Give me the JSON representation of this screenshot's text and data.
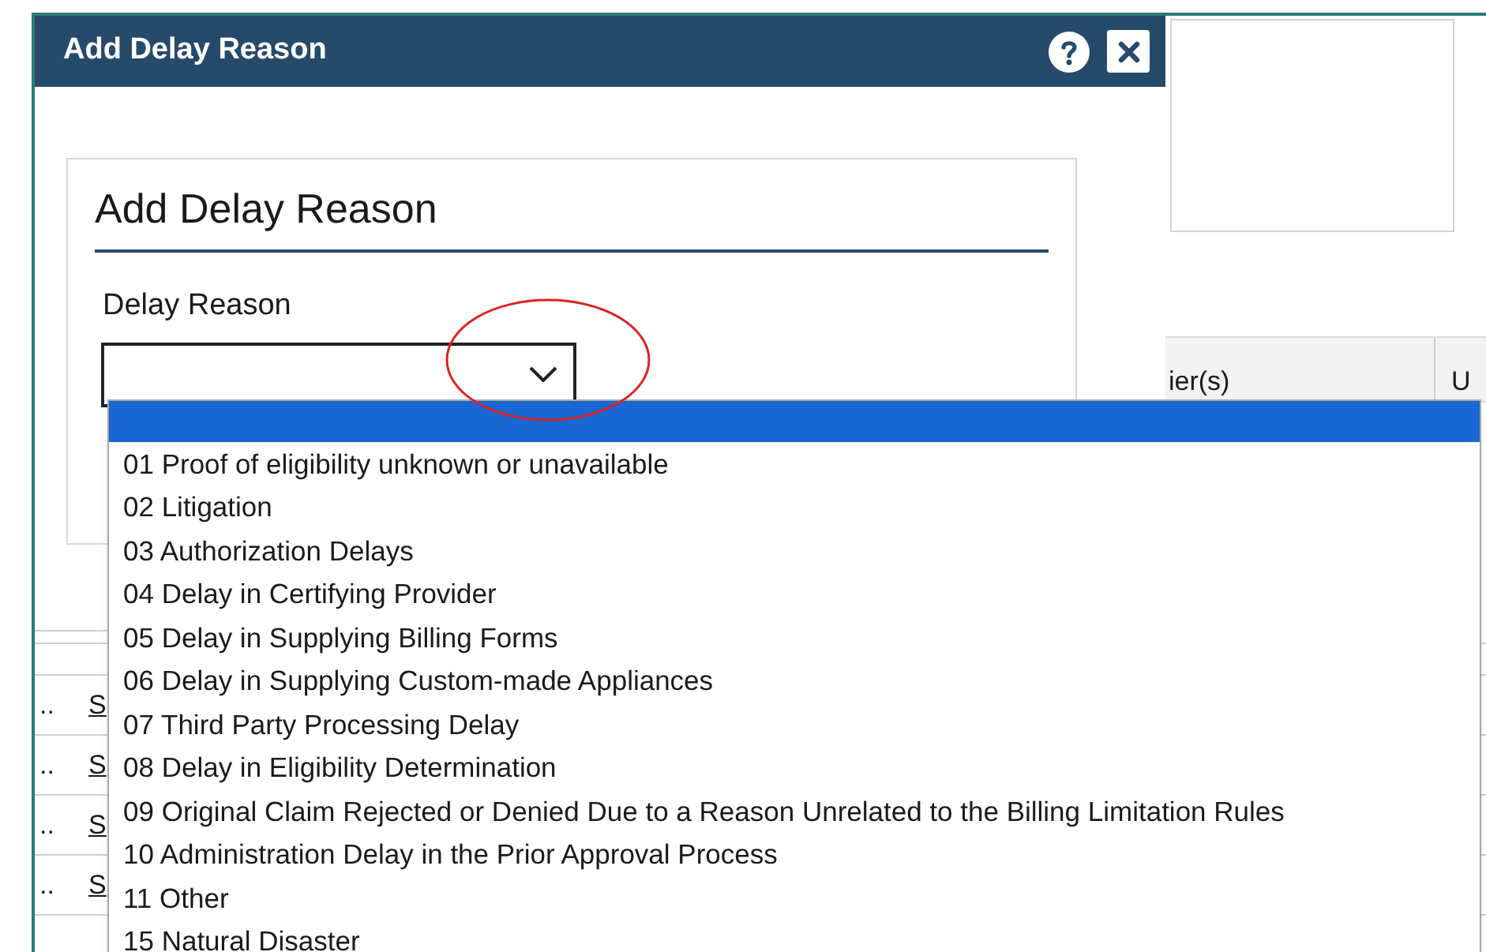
{
  "background": {
    "table_header": [
      "ier(s)",
      "U"
    ],
    "rows": [
      {
        "column_1": "..",
        "column_2": "S"
      },
      {
        "column_1": "..",
        "column_2": "S"
      },
      {
        "column_1": "..",
        "column_2": "S"
      },
      {
        "column_1": "..",
        "column_2": "S"
      }
    ]
  },
  "dialog": {
    "title": "Add Delay Reason",
    "panel_title": "Add Delay Reason",
    "field_label": "Delay Reason",
    "dropdown": {
      "expanded": true,
      "empty_option_selected": true,
      "options": [
        {
          "label": "01 Proof of eligibility unknown or unavailable",
          "selected": false
        },
        {
          "label": "02 Litigation",
          "selected": false
        },
        {
          "label": "03 Authorization Delays",
          "selected": false
        },
        {
          "label": "04 Delay in Certifying Provider",
          "selected": false
        },
        {
          "label": "05 Delay in Supplying Billing Forms",
          "selected": false
        },
        {
          "label": "06 Delay in Supplying Custom-made Appliances",
          "selected": false
        },
        {
          "label": "07 Third Party Processing Delay",
          "selected": false
        },
        {
          "label": "08 Delay in Eligibility Determination",
          "selected": false
        },
        {
          "label": "09 Original Claim Rejected or Denied Due to a Reason Unrelated to the Billing Limitation Rules",
          "selected": false
        },
        {
          "label": "10 Administration Delay in the Prior Approval Process",
          "selected": false
        },
        {
          "label": "11 Other",
          "selected": false
        },
        {
          "label": "15 Natural Disaster",
          "selected": false
        }
      ]
    }
  }
}
